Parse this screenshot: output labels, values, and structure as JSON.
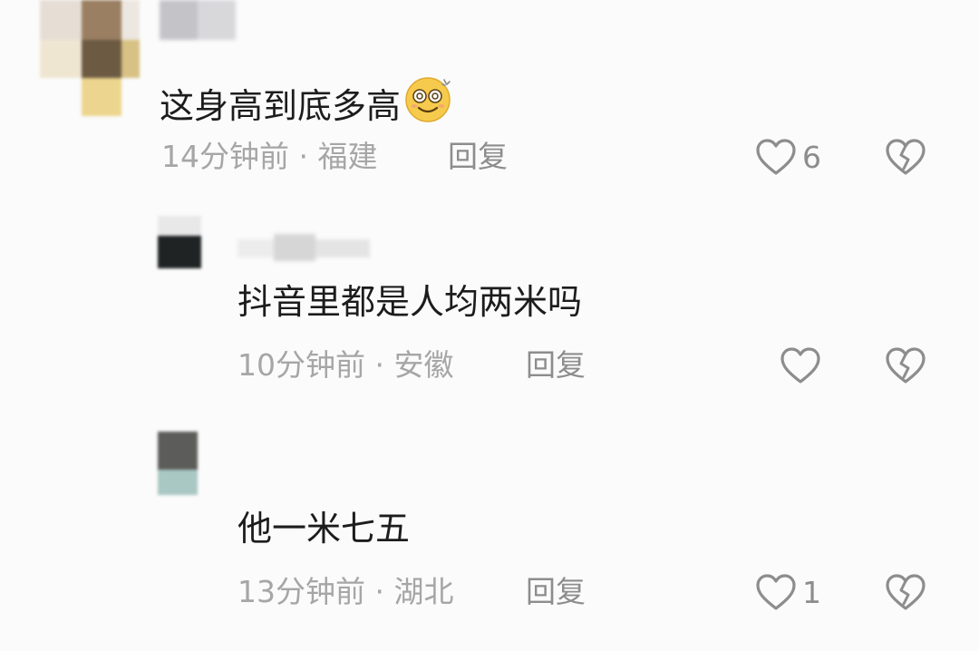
{
  "comments": [
    {
      "text": "这身高到底多高",
      "emoji": "dizzy-smile-emoji",
      "meta": "14分钟前 · 福建",
      "reply_label": "回复",
      "likes": "6"
    },
    {
      "text": "抖音里都是人均两米吗",
      "meta": "10分钟前 · 安徽",
      "reply_label": "回复",
      "likes": ""
    },
    {
      "text": "他一米七五",
      "meta": "13分钟前 · 湖北",
      "reply_label": "回复",
      "likes": "1"
    }
  ],
  "icons": {
    "like": "heart-outline-icon",
    "dislike": "broken-heart-icon"
  },
  "colors": {
    "background": "#fbfbfb",
    "text": "#1c1c1c",
    "meta": "#a6a6a6",
    "icon": "#8d8d8d"
  }
}
